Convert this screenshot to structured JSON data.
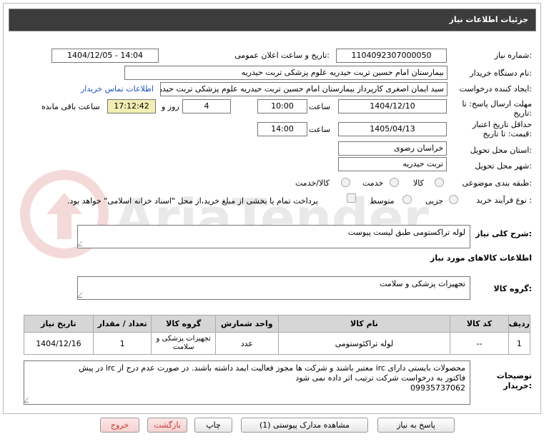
{
  "header": {
    "title": "جزئیات اطلاعات نیاز"
  },
  "fields": {
    "need_number_label": "شماره نیاز:",
    "need_number": "1104092307000050",
    "announce_label": "تاریخ و ساعت اعلان عمومی:",
    "announce_value": "1404/12/05 - 14:04",
    "buyer_label": "نام دستگاه خریدار:",
    "buyer_value": "بیمارستان امام حسین تربت حیدریه   علوم پزشکی تربت حیدریه",
    "creator_label": "ایجاد کننده درخواست:",
    "creator_value": "سید ایمان اصغری کارپرداز بیمارستان امام حسین تربت حیدریه   علوم پزشکی تربت حیدریه",
    "contact_link": "اطلاعات تماس خریدار",
    "deadline_label_1": "مهلت ارسال پاسخ: تا",
    "deadline_label_2": "تاریخ:",
    "deadline_date": "1404/12/10",
    "time_label": "ساعت",
    "deadline_time": "10:00",
    "days_value": "4",
    "days_label": "روز و",
    "remaining_time": "17:12:42",
    "remaining_label": "ساعت باقی مانده",
    "validity_label_1": "حداقل تاریخ اعتبار",
    "validity_label_2": "قیمت: تا تاریخ:",
    "validity_date": "1405/04/13",
    "validity_time": "14:00",
    "province_label": "استان محل تحویل:",
    "province_value": "خراسان رضوی",
    "city_label": "شهر محل تحویل:",
    "city_value": "تربت حیدریه",
    "category_label": "طبقه بندی موضوعی:",
    "category_options": [
      "کالا",
      "خدمت",
      "کالا/خدمت"
    ],
    "category_selected": "کالا",
    "process_label": "نوع فرآیند خرید :",
    "process_options": [
      "جزیی",
      "متوسط"
    ],
    "process_note": "پرداخت تمام یا بخشی از مبلغ خرید،از محل \"اسناد خزانه اسلامی\" خواهد بود."
  },
  "summary": {
    "label": "شرح کلی نیاز:",
    "value": "لوله تراکستومی طبق لیست پیوست"
  },
  "goods_info_title": "اطلاعات کالاهای مورد نیاز",
  "goods_group": {
    "label": "گروه کالا:",
    "value": "تجهیزات پزشکی و سلامت"
  },
  "table": {
    "headers": [
      "ردیف",
      "کد کالا",
      "نام کالا",
      "واحد شمارش",
      "گروه کالا",
      "تعداد / مقدار",
      "تاریخ نیاز"
    ],
    "rows": [
      [
        "1",
        "--",
        "لوله تراکئوستومی",
        "عدد",
        "تجهیزات پزشکی و سلامت",
        "1",
        "1404/12/16"
      ]
    ]
  },
  "buyer_notes": {
    "label_1": "توضیحات",
    "label_2": "خریدار:",
    "line1": "محصولات بایستی دارای irc  معتبر باشند و شرکت ها مجوز فعالیت ایمد داشته باشند. در صورت عدم درج از irc در پیش",
    "line2": "فاکتور به درخواست شرکت ترتیب اثر داده نمی شود",
    "line3": "09935737062"
  },
  "buttons": {
    "reply": "پاسخ به نیاز",
    "attachments": "مشاهده مدارک پیوستی (1)",
    "print": "چاپ",
    "back": "بازگشت",
    "exit": "خروج"
  },
  "watermark_text": "AriaTender.neT",
  "colors": {
    "header_bg": "#3c3c3c",
    "link": "#1a55c0",
    "remaining_bg": "#f3efb3",
    "danger": "#c0392b"
  }
}
